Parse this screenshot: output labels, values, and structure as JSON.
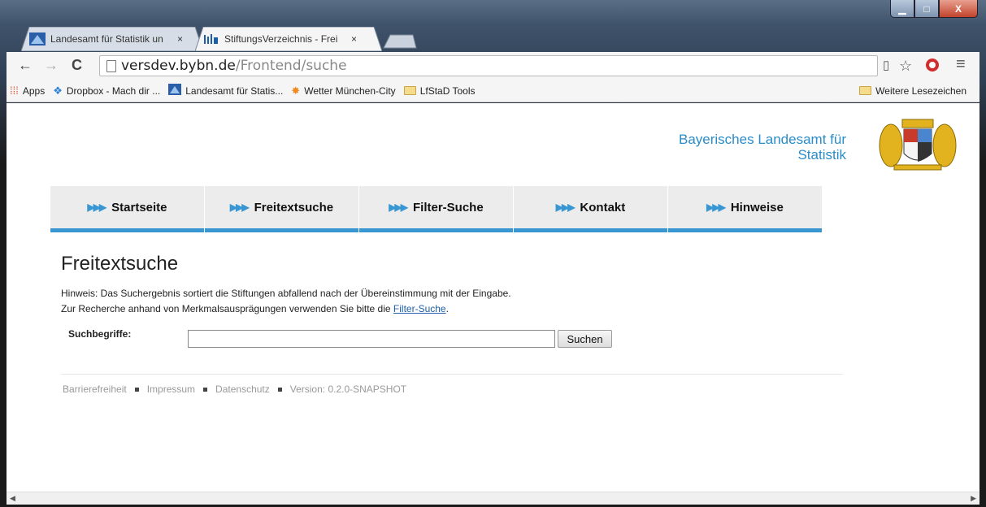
{
  "browser": {
    "tabs": [
      {
        "title": "Landesamt für Statistik un",
        "close": "×"
      },
      {
        "title": "StiftungsVerzeichnis - Frei",
        "close": "×"
      }
    ],
    "window_controls": {
      "minimize": "▁",
      "maximize": "□",
      "close": "X"
    },
    "url_host": "versdev.bybn.de",
    "url_path": "/Frontend/suche",
    "bookmarks": [
      {
        "label": "Apps",
        "icon": "apps-grid-icon"
      },
      {
        "label": "Dropbox - Mach dir ...",
        "icon": "dropbox-icon"
      },
      {
        "label": "Landesamt für Statis...",
        "icon": "lfstad-icon"
      },
      {
        "label": "Wetter München-City",
        "icon": "weather-icon"
      },
      {
        "label": "LfStaD Tools",
        "icon": "folder-icon"
      }
    ],
    "other_bookmarks": "Weitere Lesezeichen"
  },
  "page": {
    "logo_line1": "Bayerisches Landesamt für",
    "logo_line2": "Statistik",
    "nav": [
      {
        "label": "Startseite",
        "arrows": "▶▶▶"
      },
      {
        "label": "Freitextsuche",
        "arrows": "▶▶▶"
      },
      {
        "label": "Filter-Suche",
        "arrows": "▶▶▶"
      },
      {
        "label": "Kontakt",
        "arrows": "▶▶▶"
      },
      {
        "label": "Hinweise",
        "arrows": "▶▶▶"
      }
    ],
    "title": "Freitextsuche",
    "hint_line1": "Hinweis: Das Suchergebnis sortiert die Stiftungen abfallend nach der Übereinstimmung mit der Eingabe.",
    "hint_line2_prefix": "Zur Recherche anhand von Merkmalsausprägungen verwenden Sie bitte die ",
    "hint_link": "Filter-Suche",
    "hint_line2_suffix": ".",
    "search_label": "Suchbegriffe:",
    "search_value": "",
    "search_button": "Suchen",
    "footer": [
      "Barrierefreiheit",
      "Impressum",
      "Datenschutz",
      "Version: 0.2.0-SNAPSHOT"
    ]
  },
  "colors": {
    "accent": "#3896d3",
    "logo": "#2a8cc8",
    "link": "#2060a8"
  }
}
